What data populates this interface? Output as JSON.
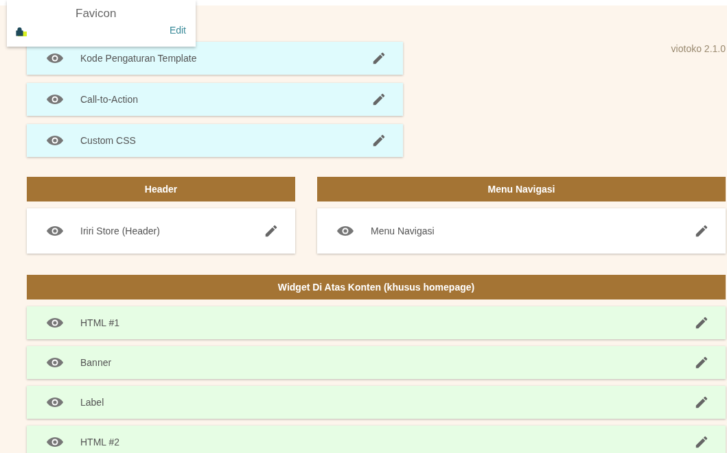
{
  "popup": {
    "title": "Favicon",
    "link": "Edit"
  },
  "version": "viotoko 2.1.0",
  "top_group": {
    "color": "#dffbfd",
    "widgets": [
      {
        "label": "Kode Pengaturan Template"
      },
      {
        "label": "Call-to-Action"
      },
      {
        "label": "Custom CSS"
      }
    ]
  },
  "columns": [
    {
      "title": "Header",
      "color": "#ffffff",
      "widgets": [
        {
          "label": "Iriri Store (Header)"
        }
      ]
    },
    {
      "title": "Menu Navigasi",
      "color": "#ffffff",
      "widgets": [
        {
          "label": "Menu Navigasi"
        }
      ]
    }
  ],
  "section": {
    "title": "Widget Di Atas Konten (khusus homepage)",
    "color": "#e6fde4",
    "widgets": [
      {
        "label": "HTML #1"
      },
      {
        "label": "Banner"
      },
      {
        "label": "Label"
      },
      {
        "label": "HTML #2"
      }
    ]
  }
}
